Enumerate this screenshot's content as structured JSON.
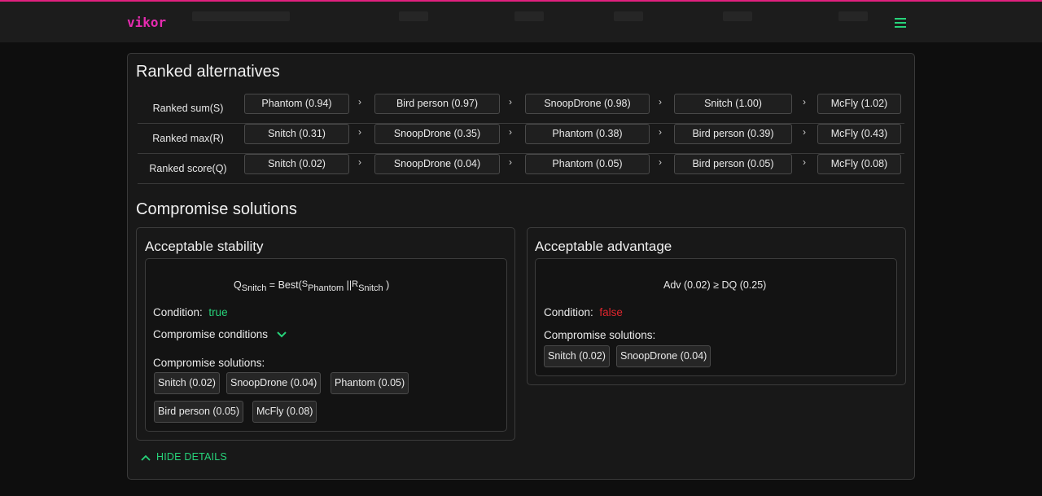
{
  "app": {
    "logo": "vikor",
    "menu_icon": "hamburger-menu-icon",
    "accent": "#27d37a",
    "brand": "#e62bb0"
  },
  "ranked": {
    "title": "Ranked alternatives",
    "separator": "›",
    "rows": [
      {
        "label": "Ranked sum(S)",
        "items": [
          "Phantom (0.94)",
          "Bird person (0.97)",
          "SnoopDrone (0.98)",
          "Snitch (1.00)",
          "McFly (1.02)"
        ]
      },
      {
        "label": "Ranked max(R)",
        "items": [
          "Snitch (0.31)",
          "SnoopDrone (0.35)",
          "Phantom (0.38)",
          "Bird person (0.39)",
          "McFly (0.43)"
        ]
      },
      {
        "label": "Ranked score(Q)",
        "items": [
          "Snitch (0.02)",
          "SnoopDrone (0.04)",
          "Phantom (0.05)",
          "Bird person (0.05)",
          "McFly (0.08)"
        ]
      }
    ]
  },
  "compromise": {
    "title": "Compromise solutions",
    "stability": {
      "title": "Acceptable stability",
      "formula": {
        "q": "Q",
        "q_sub": "Snitch",
        "eq": "= Best(",
        "s": "S",
        "s_sub": "Phantom",
        "or": "||",
        "r": "R",
        "r_sub": "Snitch",
        "close": ")"
      },
      "condition_label": "Condition:",
      "condition_value": "true",
      "conditions_label": "Compromise conditions",
      "conditions_icon": "chevron-down-icon",
      "solutions_label": "Compromise solutions:",
      "solutions": [
        "Snitch (0.02)",
        "SnoopDrone (0.04)",
        "Phantom (0.05)",
        "Bird person (0.05)",
        "McFly (0.08)"
      ]
    },
    "advantage": {
      "title": "Acceptable advantage",
      "formula": "Adv (0.02) ≥ DQ (0.25)",
      "condition_label": "Condition:",
      "condition_value": "false",
      "solutions_label": "Compromise solutions:",
      "solutions": [
        "Snitch (0.02)",
        "SnoopDrone (0.04)"
      ]
    }
  },
  "toggle": {
    "label": "HIDE DETAILS",
    "icon": "chevron-up-icon"
  }
}
